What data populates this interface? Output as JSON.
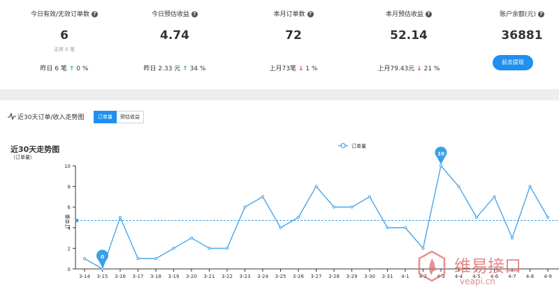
{
  "stats": [
    {
      "title": "今日有效/无效订单数",
      "value": "6",
      "sub": "无效 0 笔",
      "compare_text": "昨日 6 笔",
      "arrow": "↑",
      "arrow_dir": "up",
      "pct": "0 %"
    },
    {
      "title": "今日预估收益",
      "value": "4.74",
      "compare_text": "昨日 2.33 元",
      "arrow": "↑",
      "arrow_dir": "up",
      "pct": "34 %"
    },
    {
      "title": "本月订单数",
      "value": "72",
      "compare_text": "上月73笔",
      "arrow": "↓",
      "arrow_dir": "down",
      "pct": "1 %"
    },
    {
      "title": "本月预估收益",
      "value": "52.14",
      "compare_text": "上月79.43元",
      "arrow": "↓",
      "arrow_dir": "down",
      "pct": "21 %"
    },
    {
      "title": "账户余额(元)",
      "value": "36881",
      "button_label": "前去提现"
    }
  ],
  "help_glyph": "?",
  "panel": {
    "title": "近30天订单/收入走势图",
    "tabs": [
      {
        "label": "订单量",
        "active": true
      },
      {
        "label": "预估收益",
        "active": false
      }
    ]
  },
  "chart_data": {
    "type": "line",
    "title": "近30天走势图",
    "unit_label": "（订单量）",
    "ylabel": "订单量",
    "categories": [
      "3-14",
      "3-15",
      "3-16",
      "3-17",
      "3-18",
      "3-19",
      "3-20",
      "3-21",
      "3-22",
      "3-23",
      "3-24",
      "3-25",
      "3-26",
      "3-27",
      "3-28",
      "3-29",
      "3-30",
      "3-31",
      "4-1",
      "4-2",
      "4-3",
      "4-4",
      "4-5",
      "4-6",
      "4-7",
      "4-8",
      "4-9"
    ],
    "series": [
      {
        "name": "订单量",
        "values": [
          1,
          0,
          5,
          1,
          1,
          2,
          3,
          2,
          2,
          6,
          7,
          4,
          5,
          8,
          6,
          6,
          7,
          4,
          4,
          2,
          10,
          8,
          5,
          7,
          3,
          8,
          5
        ]
      }
    ],
    "ylim": [
      0,
      10
    ],
    "yticks": [
      0,
      2,
      4,
      6,
      8,
      10
    ],
    "average": 4.7,
    "markers": [
      {
        "label": "0",
        "category": "3-15",
        "value": 0
      },
      {
        "label": "10",
        "category": "4-3",
        "value": 10
      }
    ],
    "legend_position": "top-center",
    "color": "#3aa0e8"
  },
  "watermark": {
    "text": "维易接口",
    "url": "veapi.cn",
    "color": "#e06a6a"
  }
}
